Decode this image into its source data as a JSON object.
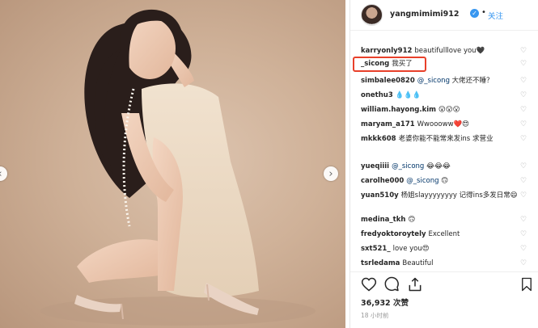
{
  "post": {
    "username": "yangmimimi912",
    "follow_label": "关注",
    "dot": "•",
    "verified_mark": "✓",
    "nav_prev": "‹",
    "nav_next": "›"
  },
  "comments": [
    {
      "user": "karryonly912",
      "text": "beautifulllove you",
      "emoji": "🖤"
    },
    {
      "user": "_sicong",
      "text": "我买了",
      "highlighted": true
    },
    {
      "user": "simbalee0820",
      "mention": "@_sicong",
      "text": "大佬还不睡？"
    },
    {
      "user": "onethu3",
      "text": "💧💧💧"
    },
    {
      "user": "william.hayong.kim",
      "text": "😮😮😮"
    },
    {
      "user": "maryam_a171",
      "text": "Wwoooww❤️😍"
    },
    {
      "user": "mkkk608",
      "text": "老婆你能不能常来发ins 求营业"
    },
    {
      "user": "yueqiiii",
      "mention": "@_sicong",
      "text": "😂😂😂"
    },
    {
      "user": "carolhe000",
      "mention": "@_sicong",
      "text": "🙃"
    },
    {
      "user": "yuan510y",
      "text": "杨姐slayyyyyyyy 记得ins多发日常😄"
    },
    {
      "user": "medina_tkh",
      "text": "🙃"
    },
    {
      "user": "fredyoktoroytely",
      "text": "Excellent"
    },
    {
      "user": "sxt521_",
      "text": "love you😍"
    },
    {
      "user": "tsrledama",
      "text": "Beautiful"
    }
  ],
  "stats": {
    "likes": "36,932 次赞",
    "time": "18 小时前"
  },
  "icons": [
    "heart-icon",
    "comment-icon",
    "share-icon",
    "bookmark-icon",
    "verified-icon"
  ],
  "colors": {
    "link_blue": "#3897f0",
    "highlight_red": "#e8402a",
    "photo_bg": "#cfb198"
  }
}
